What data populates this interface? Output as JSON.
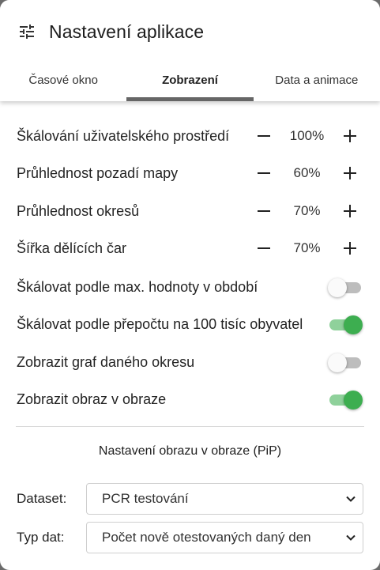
{
  "header": {
    "title": "Nastavení aplikace",
    "icon": "tune-icon"
  },
  "tabs": [
    {
      "label": "Časové okno",
      "active": false
    },
    {
      "label": "Zobrazení",
      "active": true
    },
    {
      "label": "Data a animace",
      "active": false
    }
  ],
  "steppers": [
    {
      "label": "Škálování uživatelského prostředí",
      "value": "100%"
    },
    {
      "label": "Průhlednost pozadí mapy",
      "value": "60%"
    },
    {
      "label": "Průhlednost okresů",
      "value": "70%"
    },
    {
      "label": "Šířka dělících čar",
      "value": "70%"
    }
  ],
  "toggles": [
    {
      "label": "Škálovat podle max. hodnoty v období",
      "on": false
    },
    {
      "label": "Škálovat podle přepočtu na 100 tisíc obyvatel",
      "on": true
    },
    {
      "label": "Zobrazit graf daného okresu",
      "on": false
    },
    {
      "label": "Zobrazit obraz v obraze",
      "on": true
    }
  ],
  "pip": {
    "title": "Nastavení obrazu v obraze (PiP)",
    "dataset_label": "Dataset:",
    "dataset_value": "PCR testování",
    "type_label": "Typ dat:",
    "type_value": "Počet nově otestovaných daný den"
  },
  "colors": {
    "accent_on": "#3dae50",
    "track_on": "#8fd19b",
    "track_off": "#bdbdbd",
    "tab_indicator": "#666666"
  }
}
